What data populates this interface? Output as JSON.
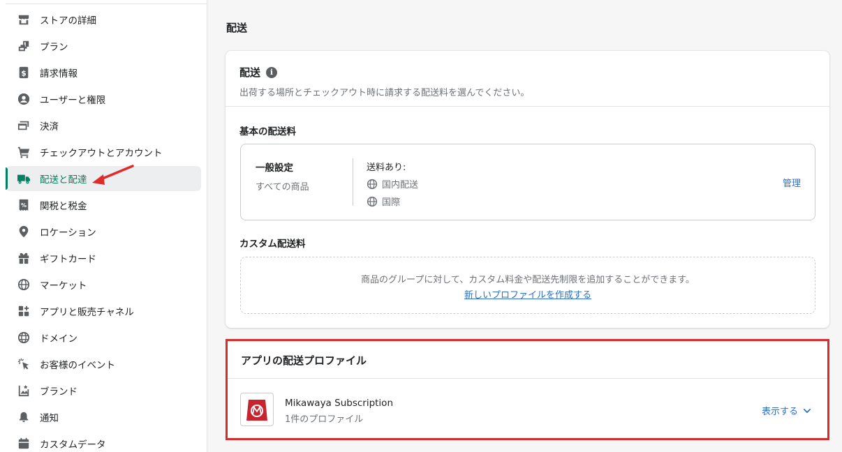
{
  "sidebar": {
    "items": [
      {
        "label": "ストアの詳細",
        "icon": "store-icon"
      },
      {
        "label": "プラン",
        "icon": "plan-icon"
      },
      {
        "label": "請求情報",
        "icon": "billing-icon"
      },
      {
        "label": "ユーザーと権限",
        "icon": "user-icon"
      },
      {
        "label": "決済",
        "icon": "payment-icon"
      },
      {
        "label": "チェックアウトとアカウント",
        "icon": "cart-icon"
      },
      {
        "label": "配送と配達",
        "icon": "truck-icon",
        "active": true
      },
      {
        "label": "関税と税金",
        "icon": "tax-icon"
      },
      {
        "label": "ロケーション",
        "icon": "location-icon"
      },
      {
        "label": "ギフトカード",
        "icon": "gift-icon"
      },
      {
        "label": "マーケット",
        "icon": "globe-icon"
      },
      {
        "label": "アプリと販売チャネル",
        "icon": "apps-icon"
      },
      {
        "label": "ドメイン",
        "icon": "domain-icon"
      },
      {
        "label": "お客様のイベント",
        "icon": "cursor-icon"
      },
      {
        "label": "ブランド",
        "icon": "brand-icon"
      },
      {
        "label": "通知",
        "icon": "bell-icon"
      },
      {
        "label": "カスタムデータ",
        "icon": "data-icon"
      }
    ]
  },
  "page": {
    "title": "配送"
  },
  "shipping_card": {
    "title": "配送",
    "description": "出荷する場所とチェックアウト時に請求する配送料を選んでください。",
    "basic_title": "基本の配送料",
    "general": {
      "name": "一般設定",
      "sub": "すべての商品"
    },
    "rates": {
      "heading": "送料あり:",
      "domestic": "国内配送",
      "international": "国際"
    },
    "manage_label": "管理",
    "custom_title": "カスタム配送料",
    "custom_text": "商品のグループに対して、カスタム料金や配送先制限を追加することができます。",
    "custom_link": "新しいプロファイルを作成する"
  },
  "app_card": {
    "title": "アプリの配送プロファイル",
    "app_name": "Mikawaya Subscription",
    "app_sub": "1件のプロファイル",
    "show_label": "表示する"
  },
  "colors": {
    "accent": "#008060",
    "link": "#2c6ecb",
    "highlight": "#d72c2c"
  }
}
